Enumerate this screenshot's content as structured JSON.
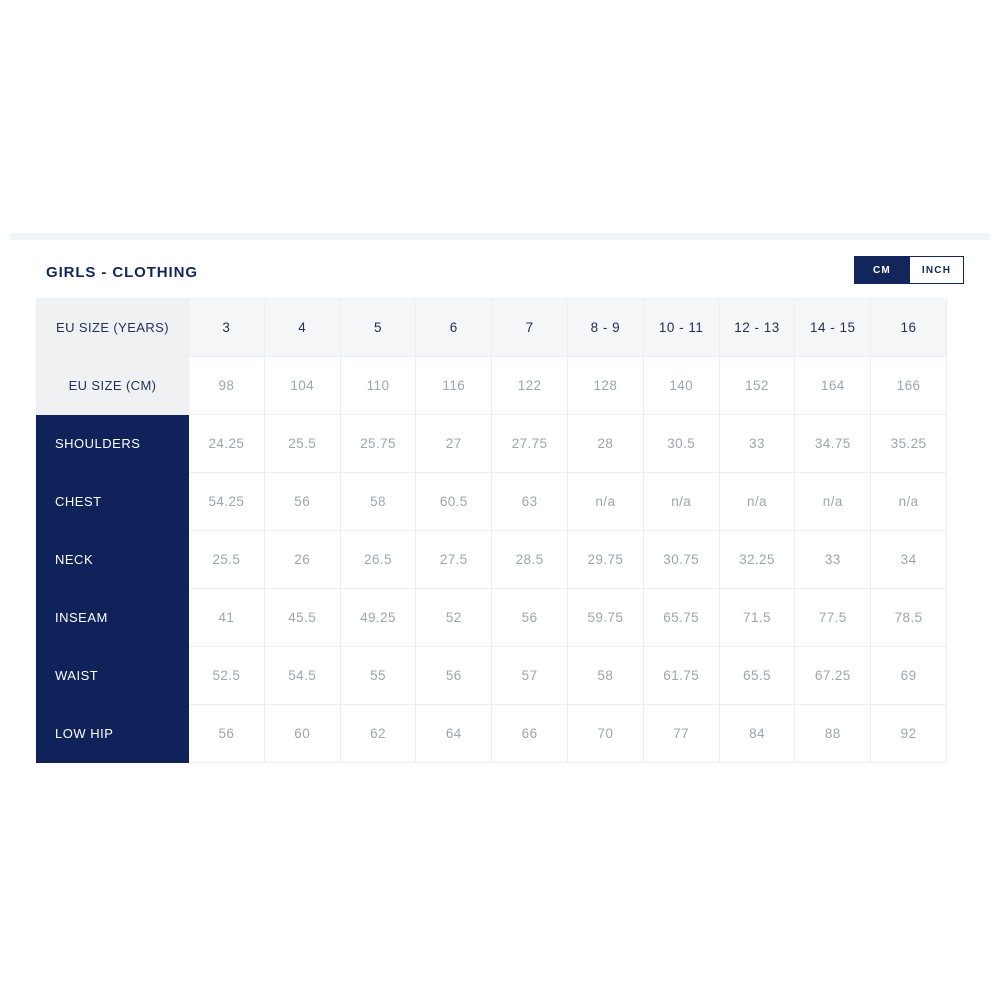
{
  "card": {
    "title": "GIRLS - CLOTHING",
    "unit_toggle": {
      "cm_label": "CM",
      "inch_label": "INCH",
      "selected": "CM"
    },
    "colors": {
      "navy": "#0f2259",
      "title_navy": "#12265c",
      "header_bg": "#f5f6f7",
      "label_bg": "#f0f1f3",
      "value_text": "#a0a4ad",
      "border": "#eceef1"
    }
  },
  "chart_data": {
    "type": "table",
    "title": "GIRLS - CLOTHING",
    "unit": "CM",
    "row_header_labels": [
      "EU SIZE (YEARS)",
      "EU SIZE (CM)"
    ],
    "categories": [
      "3",
      "4",
      "5",
      "6",
      "7",
      "8 - 9",
      "10 - 11",
      "12 - 13",
      "14 - 15",
      "16"
    ],
    "eu_size_cm": [
      "98",
      "104",
      "110",
      "116",
      "122",
      "128",
      "140",
      "152",
      "164",
      "166"
    ],
    "series": [
      {
        "name": "SHOULDERS",
        "values": [
          "24.25",
          "25.5",
          "25.75",
          "27",
          "27.75",
          "28",
          "30.5",
          "33",
          "34.75",
          "35.25"
        ]
      },
      {
        "name": "CHEST",
        "values": [
          "54.25",
          "56",
          "58",
          "60.5",
          "63",
          "n/a",
          "n/a",
          "n/a",
          "n/a",
          "n/a"
        ]
      },
      {
        "name": "NECK",
        "values": [
          "25.5",
          "26",
          "26.5",
          "27.5",
          "28.5",
          "29.75",
          "30.75",
          "32.25",
          "33",
          "34"
        ]
      },
      {
        "name": "INSEAM",
        "values": [
          "41",
          "45.5",
          "49.25",
          "52",
          "56",
          "59.75",
          "65.75",
          "71.5",
          "77.5",
          "78.5"
        ]
      },
      {
        "name": "WAIST",
        "values": [
          "52.5",
          "54.5",
          "55",
          "56",
          "57",
          "58",
          "61.75",
          "65.5",
          "67.25",
          "69"
        ]
      },
      {
        "name": "LOW HIP",
        "values": [
          "56",
          "60",
          "62",
          "64",
          "66",
          "70",
          "77",
          "84",
          "88",
          "92"
        ]
      }
    ]
  }
}
